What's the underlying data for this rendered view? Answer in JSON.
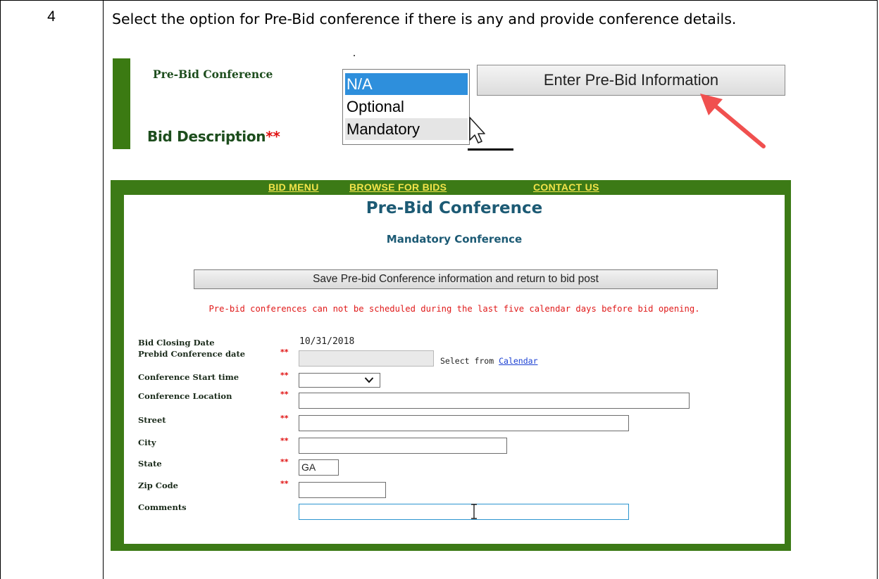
{
  "step": {
    "number": "4",
    "instruction": "Select the option for Pre-Bid conference if there is any and provide conference details."
  },
  "top_form": {
    "prebid_label": "Pre-Bid Conference",
    "bid_description_label": "Bid Description",
    "required_marker": "**",
    "dropdown_options": [
      {
        "label": "N/A",
        "state": "selected"
      },
      {
        "label": "Optional",
        "state": "normal"
      },
      {
        "label": "Mandatory",
        "state": "hover"
      }
    ],
    "enter_button_label": "Enter Pre-Bid Information"
  },
  "page": {
    "nav": [
      "BID MENU",
      "BROWSE FOR BIDS",
      "CONTACT US"
    ],
    "title": "Pre-Bid Conference",
    "subtitle": "Mandatory Conference",
    "save_button_label": "Save Pre-bid Conference information and return to bid post",
    "warning": "Pre-bid conferences can not be scheduled during the last five calendar days before bid opening.",
    "fields": {
      "bid_closing_date_label": "Bid Closing Date",
      "bid_closing_date_value": "10/31/2018",
      "prebid_date_label": "Prebid Conference date",
      "select_from_text": "Select from",
      "calendar_link": "Calendar",
      "start_time_label": "Conference Start time",
      "location_label": "Conference Location",
      "street_label": "Street",
      "city_label": "City",
      "state_label": "State",
      "state_value": "GA",
      "zip_label": "Zip Code",
      "comments_label": "Comments",
      "required_marker": "**"
    }
  },
  "colors": {
    "frame_green": "#3c7a16",
    "nav_link": "#f2e34a",
    "title_blue": "#1c5a74",
    "required_red": "#e01010",
    "selected_blue": "#2e8fdc",
    "arrow_red": "#f0504f"
  }
}
